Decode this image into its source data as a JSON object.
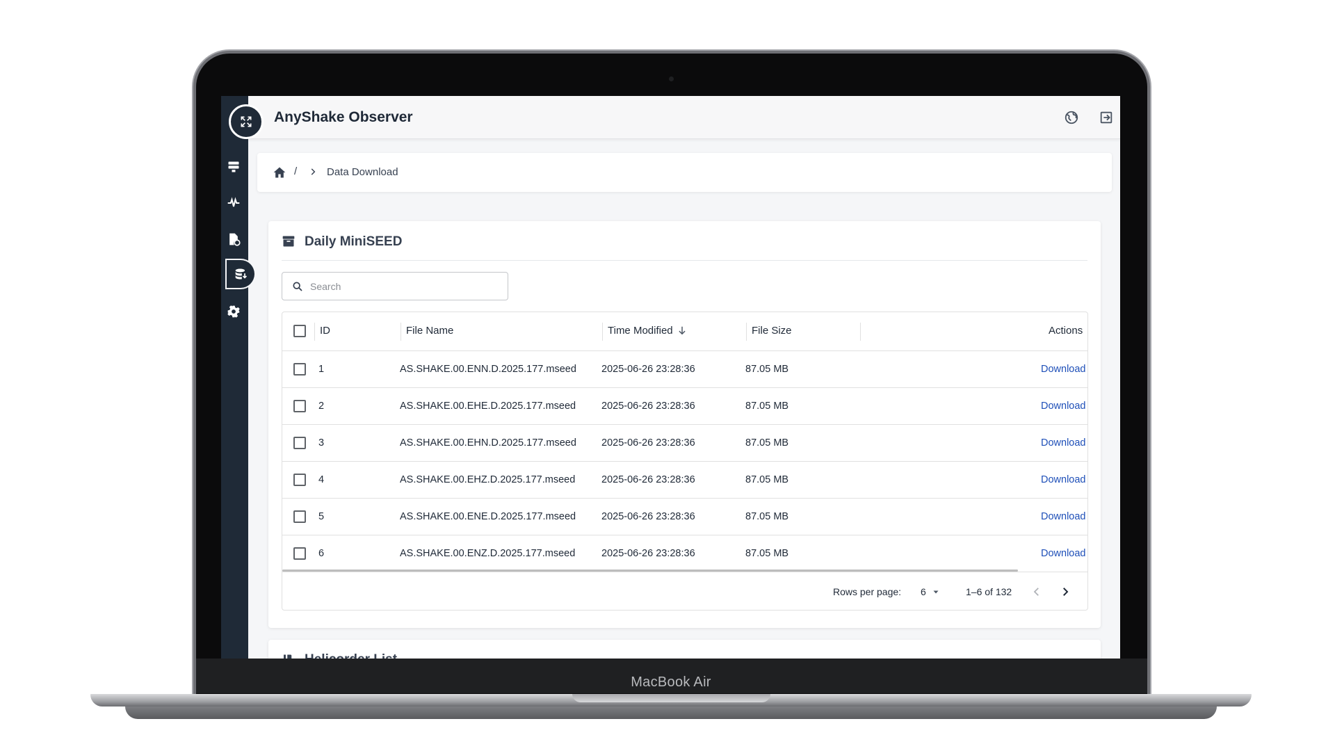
{
  "device": {
    "brand": "MacBook Air"
  },
  "app": {
    "title": "AnyShake Observer"
  },
  "topbar": {
    "icons": [
      "globe-icon",
      "logout-icon"
    ]
  },
  "sidebar": {
    "items": [
      {
        "icon": "server-icon",
        "active": false
      },
      {
        "icon": "waveform-icon",
        "active": false
      },
      {
        "icon": "file-history-icon",
        "active": false
      },
      {
        "icon": "database-download-icon",
        "active": true
      },
      {
        "icon": "settings-gear-icon",
        "active": false
      }
    ]
  },
  "breadcrumb": {
    "separator": "/",
    "current": "Data Download"
  },
  "panel": {
    "title": "Daily MiniSEED",
    "search_placeholder": "Search",
    "columns": [
      "ID",
      "File Name",
      "Time Modified",
      "File Size",
      "Actions"
    ],
    "rows": [
      {
        "id": "1",
        "file": "AS.SHAKE.00.ENN.D.2025.177.mseed",
        "modified": "2025-06-26 23:28:36",
        "size": "87.05 MB",
        "action": "Download"
      },
      {
        "id": "2",
        "file": "AS.SHAKE.00.EHE.D.2025.177.mseed",
        "modified": "2025-06-26 23:28:36",
        "size": "87.05 MB",
        "action": "Download"
      },
      {
        "id": "3",
        "file": "AS.SHAKE.00.EHN.D.2025.177.mseed",
        "modified": "2025-06-26 23:28:36",
        "size": "87.05 MB",
        "action": "Download"
      },
      {
        "id": "4",
        "file": "AS.SHAKE.00.EHZ.D.2025.177.mseed",
        "modified": "2025-06-26 23:28:36",
        "size": "87.05 MB",
        "action": "Download"
      },
      {
        "id": "5",
        "file": "AS.SHAKE.00.ENE.D.2025.177.mseed",
        "modified": "2025-06-26 23:28:36",
        "size": "87.05 MB",
        "action": "Download"
      },
      {
        "id": "6",
        "file": "AS.SHAKE.00.ENZ.D.2025.177.mseed",
        "modified": "2025-06-26 23:28:36",
        "size": "87.05 MB",
        "action": "Download"
      }
    ],
    "footer": {
      "rows_per_page_label": "Rows per page:",
      "rows_per_page_value": "6",
      "range": "1–6 of 132"
    }
  },
  "panel2": {
    "title": "Helicorder List"
  },
  "colors": {
    "sidebar": "#1f2a37",
    "link": "#1e4fb8",
    "accent_text": "#374151"
  }
}
